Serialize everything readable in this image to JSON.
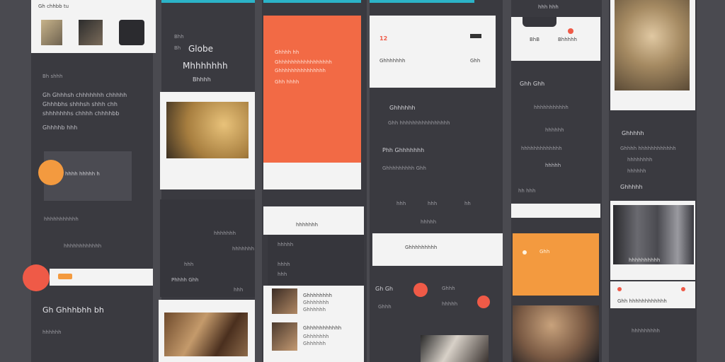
{
  "colors": {
    "page_bg": "#4a4a50",
    "column_bg": "#3a3a40",
    "card_dark": "#36363c",
    "card_light": "#f3f3f3",
    "accent_orange": "#f26a45",
    "accent_amber": "#f39a3f",
    "accent_red": "#ef5a47",
    "accent_teal": "#2bb3c8"
  },
  "col1": {
    "top_card": {
      "caption": "Gh chhbb tu"
    },
    "title_small": "Bh shhh",
    "paragraph": [
      "Gh Ghhhsh chhhhhhh chhhhh",
      "Ghhhbhs shhhsh shhh chh",
      "shhhhhhhs chhhh chhhhbb",
      "Ghhhhb hhh"
    ],
    "media_label": "hhhh hhhhh h",
    "list_a": "hhhhhhhhhhh",
    "list_b": "hhhhhhhhhhhh",
    "bottom_title": "Gh Ghhhbhh bh",
    "bottom_sub": "hhhhhh"
  },
  "col2": {
    "label_small": "Bhh",
    "label_small2": "Bh",
    "headline": "Globe",
    "headline2": "Mhhhhhhh",
    "headline3": "Bhhhh",
    "mid_label": "hhhhhhh",
    "mid_label2": "hhhhhhh",
    "mid_label3": "hhh",
    "mid_label4": "Phhhh Ghh",
    "mid_label5": "hhh"
  },
  "col3": {
    "orange_lines": [
      "Ghhhh hh",
      "Ghhhhhhhhhhhhhhhhh",
      "Ghhhhhhhhhhhhhhh",
      "Ghh hhhh"
    ],
    "white_header": "hhhhhhh",
    "panel_rows": [
      "hhhhh",
      "hhhh",
      "hhh"
    ],
    "list_items": [
      {
        "title": "Ghhhhhhhh",
        "sub": "Ghhhhhhh",
        "sub2": "Ghhhhhh"
      },
      {
        "title": "Ghhhhhhhhhhh",
        "sub": "Ghhhhhhh",
        "sub2": "Ghhhhhh"
      }
    ]
  },
  "col4": {
    "top_badge": "12",
    "top_line": "Ghhhhhhh",
    "top_right": "Ghh",
    "section_title": "Ghhhhhh",
    "section_lines": [
      "Ghh hhhhhhhhhhhhhhhh",
      "Phh Ghhhhhhh",
      "Ghhhhhhhhh  Ghh"
    ],
    "stats": [
      "hhh",
      "hhh",
      "hh"
    ],
    "stats_label": "hhhhh",
    "white_bar": "Ghhhhhhhhh",
    "bottom_a": "Gh Gh",
    "bottom_b": "Ghhh",
    "bottom_c": "Ghhh",
    "bottom_d": "hhhhh"
  },
  "col5": {
    "top_tab": "hhh hhh",
    "card_label": "BhB",
    "card_label2": "Bhhhhh",
    "section_title": "Ghh Ghh",
    "lines": [
      "hhhhhhhhhhh",
      "hhhhhh",
      "hhhhhhhhhhhhh",
      "hhhhh"
    ],
    "small": "hh hhh",
    "amber_label": "Ghh"
  },
  "col6": {
    "title": "Ghhhhh",
    "lines": [
      "Ghhhh hhhhhhhhhhhh",
      "hhhhhhhh",
      "hhhhhh"
    ],
    "sub_title": "Ghhhhh",
    "photo_caption": "hhhhhhhhhh",
    "white_row": "Ghh hhhhhhhhhhhh",
    "bottom": "hhhhhhhhh"
  }
}
